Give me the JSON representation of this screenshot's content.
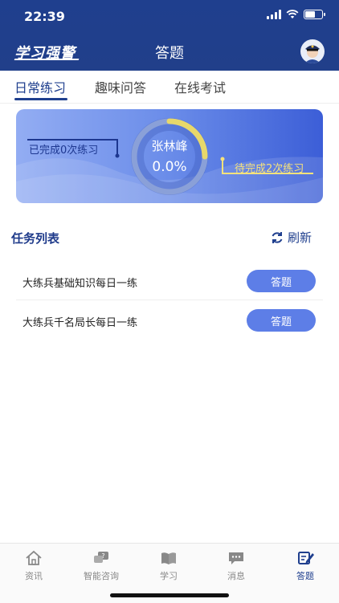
{
  "status_bar": {
    "time": "22:39"
  },
  "header": {
    "logo_text": "学习强警",
    "title": "答题"
  },
  "tabs": [
    {
      "label": "日常练习",
      "active": true
    },
    {
      "label": "趣味问答",
      "active": false
    },
    {
      "label": "在线考试",
      "active": false
    }
  ],
  "progress_card": {
    "user_name": "张林峰",
    "percent": "0.0%",
    "completed_text": "已完成0次练习",
    "pending_text": "待完成2次练习"
  },
  "tasks": {
    "title": "任务列表",
    "refresh_label": "刷新",
    "items": [
      {
        "name": "大练兵基础知识每日一练",
        "button": "答题"
      },
      {
        "name": "大练兵千名局长每日一练",
        "button": "答题"
      }
    ]
  },
  "bottom_nav": [
    {
      "label": "资讯",
      "icon": "home-icon",
      "active": false
    },
    {
      "label": "智能咨询",
      "icon": "chat-question-icon",
      "active": false
    },
    {
      "label": "学习",
      "icon": "book-icon",
      "active": false
    },
    {
      "label": "消息",
      "icon": "message-icon",
      "active": false
    },
    {
      "label": "答题",
      "icon": "edit-icon",
      "active": true
    }
  ],
  "colors": {
    "primary": "#1f3f8e",
    "accent": "#5d7ee7",
    "pending": "#f6e27b"
  }
}
